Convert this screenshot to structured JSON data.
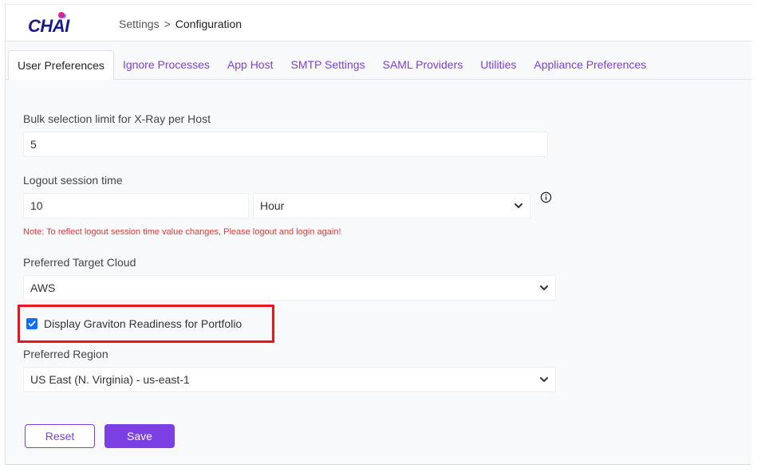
{
  "app": {
    "logo_text": "CHAI"
  },
  "breadcrumb": {
    "root": "Settings",
    "separator": ">",
    "current": "Configuration"
  },
  "tabs": [
    {
      "label": "User Preferences",
      "active": true
    },
    {
      "label": "Ignore Processes",
      "active": false
    },
    {
      "label": "App Host",
      "active": false
    },
    {
      "label": "SMTP Settings",
      "active": false
    },
    {
      "label": "SAML Providers",
      "active": false
    },
    {
      "label": "Utilities",
      "active": false
    },
    {
      "label": "Appliance Preferences",
      "active": false
    }
  ],
  "form": {
    "bulk_limit": {
      "label": "Bulk selection limit for X-Ray per Host",
      "value": "5"
    },
    "logout": {
      "label": "Logout session time",
      "value": "10",
      "unit": "Hour",
      "note": "Note: To reflect logout session time value changes, Please logout and login again!"
    },
    "target_cloud": {
      "label": "Preferred Target Cloud",
      "value": "AWS"
    },
    "graviton": {
      "label": "Display Graviton Readiness for Portfolio",
      "checked": true
    },
    "region": {
      "label": "Preferred Region",
      "value": "US East (N. Virginia) - us-east-1"
    },
    "buttons": {
      "reset": "Reset",
      "save": "Save"
    }
  },
  "icons": {
    "chevron": "chevron-down-icon",
    "info": "info-icon",
    "check": "check-icon"
  },
  "colors": {
    "accent": "#7b3fe4",
    "checkbox": "#0d6efd",
    "note": "#e03a3a",
    "highlight": "#e8161b",
    "logo": "#1a1a8c"
  }
}
